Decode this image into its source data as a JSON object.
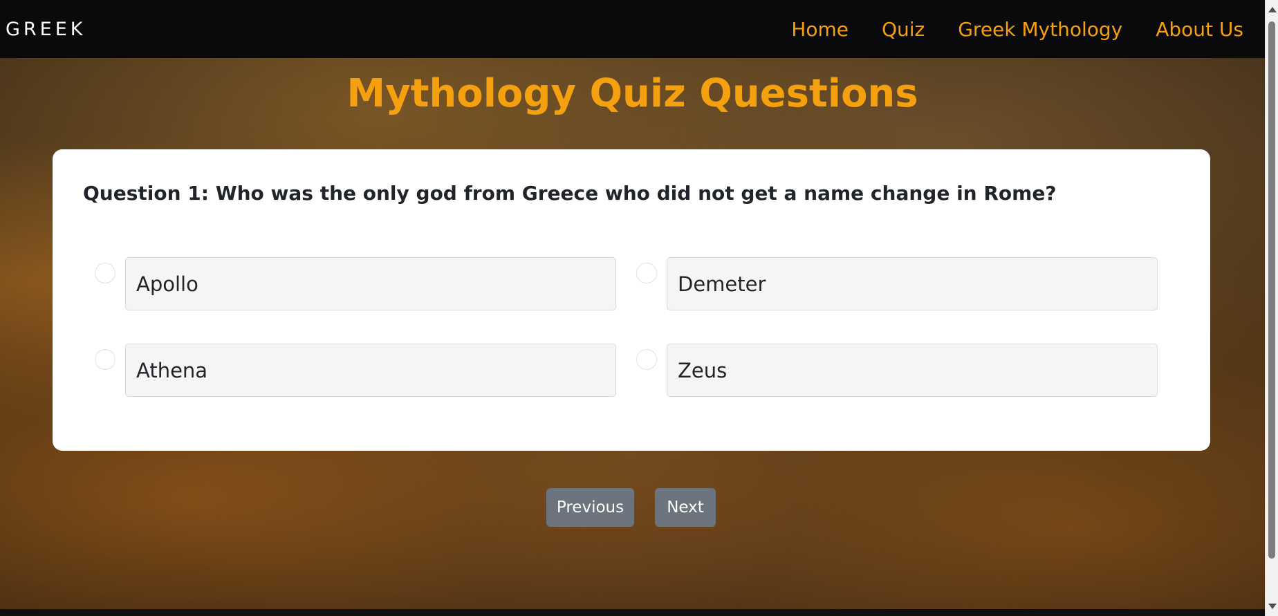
{
  "navbar": {
    "brand": "GREEK",
    "links": [
      "Home",
      "Quiz",
      "Greek Mythology",
      "About Us"
    ]
  },
  "hero": {
    "title": "Mythology Quiz Questions"
  },
  "quiz": {
    "question": "Question 1: Who was the only god from Greece who did not get a name change in Rome?",
    "options": [
      "Apollo",
      "Demeter",
      "Athena",
      "Zeus"
    ],
    "selected": null
  },
  "buttons": {
    "previous": "Previous",
    "next": "Next"
  },
  "colors": {
    "accent": "#f5a00f",
    "navbar_bg": "#0a090b",
    "button_bg": "#6c757d",
    "card_bg": "#ffffff"
  }
}
